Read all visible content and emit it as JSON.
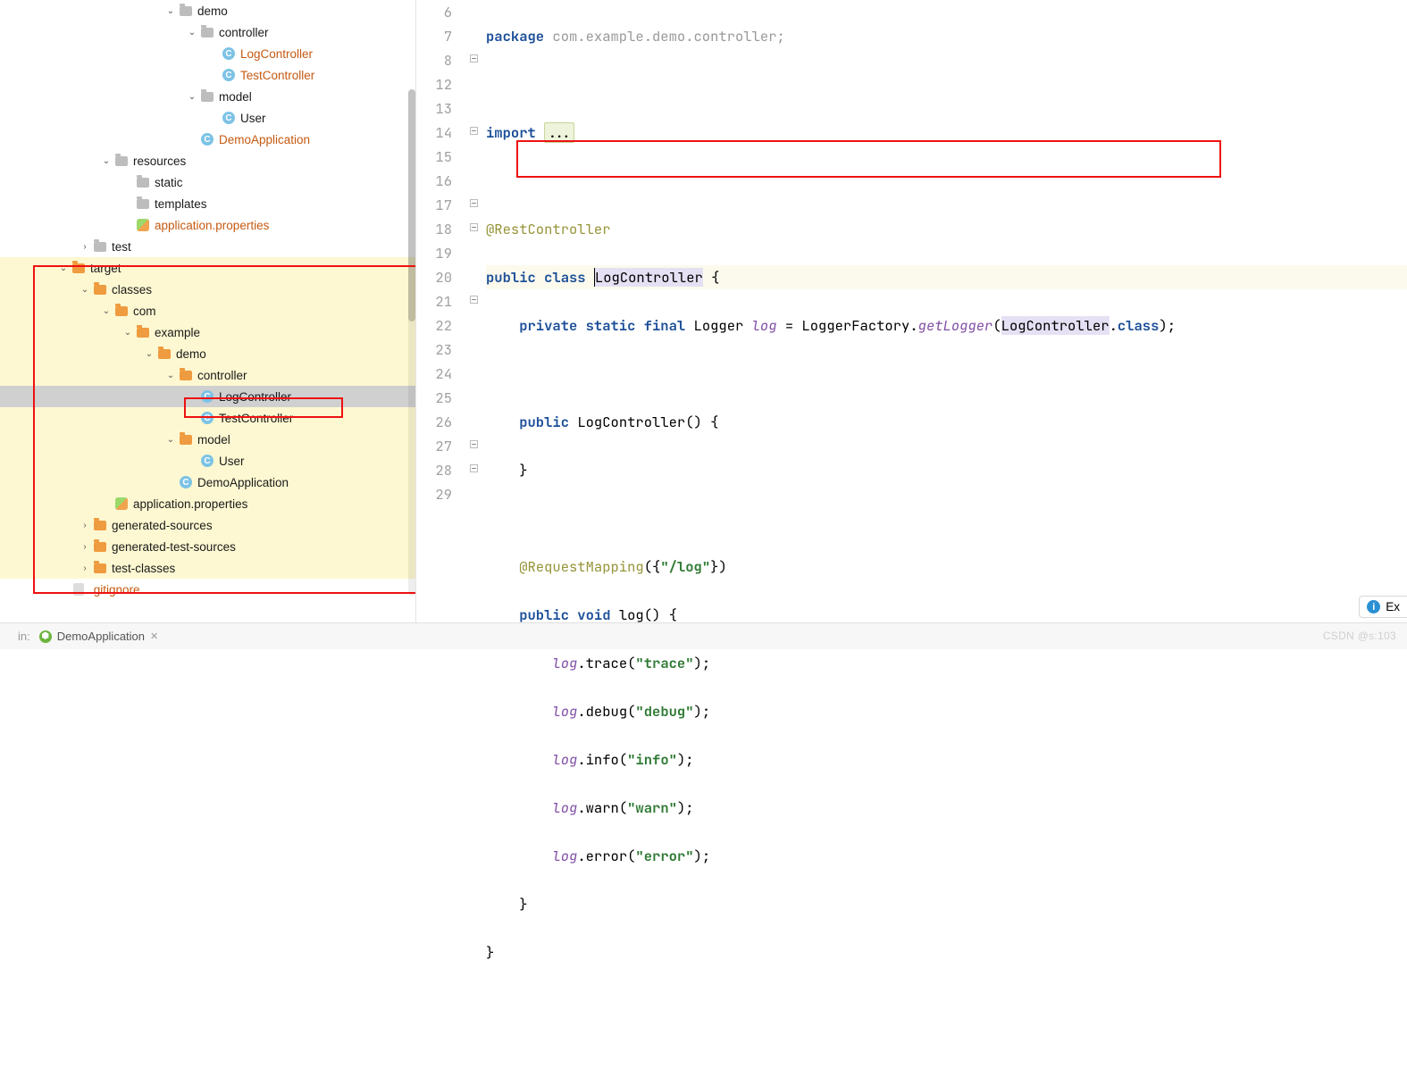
{
  "tree": [
    {
      "indent": 6,
      "arrow": "down",
      "icon": "folder-grey",
      "label": "demo"
    },
    {
      "indent": 7,
      "arrow": "down",
      "icon": "folder-grey",
      "label": "controller"
    },
    {
      "indent": 8,
      "arrow": "",
      "icon": "class",
      "label": "LogController",
      "orange": true
    },
    {
      "indent": 8,
      "arrow": "",
      "icon": "class",
      "label": "TestController",
      "orange": true
    },
    {
      "indent": 7,
      "arrow": "down",
      "icon": "folder-grey",
      "label": "model"
    },
    {
      "indent": 8,
      "arrow": "",
      "icon": "class",
      "label": "User"
    },
    {
      "indent": 7,
      "arrow": "",
      "icon": "class",
      "label": "DemoApplication",
      "orange": true
    },
    {
      "indent": 3,
      "arrow": "down",
      "icon": "folder-grey",
      "label": "resources"
    },
    {
      "indent": 4,
      "arrow": "",
      "icon": "folder-grey",
      "label": "static"
    },
    {
      "indent": 4,
      "arrow": "",
      "icon": "folder-grey",
      "label": "templates"
    },
    {
      "indent": 4,
      "arrow": "",
      "icon": "prop",
      "label": "application.properties",
      "orange": true
    },
    {
      "indent": 2,
      "arrow": "right",
      "icon": "folder-grey",
      "label": "test"
    },
    {
      "indent": 1,
      "arrow": "down",
      "icon": "folder-orange",
      "label": "target",
      "hl": true
    },
    {
      "indent": 2,
      "arrow": "down",
      "icon": "folder-orange",
      "label": "classes",
      "hl": true
    },
    {
      "indent": 3,
      "arrow": "down",
      "icon": "folder-orange",
      "label": "com",
      "hl": true
    },
    {
      "indent": 4,
      "arrow": "down",
      "icon": "folder-orange",
      "label": "example",
      "hl": true
    },
    {
      "indent": 5,
      "arrow": "down",
      "icon": "folder-orange",
      "label": "demo",
      "hl": true
    },
    {
      "indent": 6,
      "arrow": "down",
      "icon": "folder-orange",
      "label": "controller",
      "hl": true
    },
    {
      "indent": 7,
      "arrow": "",
      "icon": "class",
      "label": "LogController",
      "hl": true,
      "selected": true
    },
    {
      "indent": 7,
      "arrow": "",
      "icon": "class",
      "label": "TestController",
      "hl": true
    },
    {
      "indent": 6,
      "arrow": "down",
      "icon": "folder-orange",
      "label": "model",
      "hl": true
    },
    {
      "indent": 7,
      "arrow": "",
      "icon": "class",
      "label": "User",
      "hl": true
    },
    {
      "indent": 6,
      "arrow": "",
      "icon": "class",
      "label": "DemoApplication",
      "hl": true
    },
    {
      "indent": 3,
      "arrow": "",
      "icon": "prop",
      "label": "application.properties",
      "hl": true
    },
    {
      "indent": 2,
      "arrow": "right",
      "icon": "folder-orange",
      "label": "generated-sources",
      "hl": true
    },
    {
      "indent": 2,
      "arrow": "right",
      "icon": "folder-orange",
      "label": "generated-test-sources",
      "hl": true
    },
    {
      "indent": 2,
      "arrow": "right",
      "icon": "folder-orange",
      "label": "test-classes",
      "hl": true
    },
    {
      "indent": 1,
      "arrow": "",
      "icon": "file",
      "label": ".gitignore",
      "orange": true
    }
  ],
  "lineNumbers": [
    "6",
    "7",
    "8",
    "12",
    "13",
    "14",
    "15",
    "16",
    "17",
    "18",
    "19",
    "20",
    "21",
    "22",
    "23",
    "24",
    "25",
    "26",
    "27",
    "28",
    "29"
  ],
  "code": {
    "l0a": "package",
    "l0b": " com.example.demo.controller;",
    "l2a": "import ",
    "l2b": "...",
    "l4": "@RestController",
    "l5a": "public class ",
    "l5b": "LogController",
    "l5c": " {",
    "l6a": "private static final",
    "l6b": " Logger ",
    "l6c": "log",
    "l6d": " = LoggerFactory.",
    "l6e": "getLogger",
    "l6f": "(",
    "l6g": "LogController",
    "l6h": ".",
    "l6i": "class",
    "l6j": ");",
    "l8a": "public",
    "l8b": " LogController() {",
    "l9a": "}",
    "l11a": "@RequestMapping",
    "l11b": "({",
    "l11c": "\"/log\"",
    "l11d": "})",
    "l12a": "public void",
    "l12b": " log() {",
    "l13a": "log",
    "l13b": ".trace(",
    "l13c": "\"trace\"",
    "l13d": ");",
    "l14a": "log",
    "l14b": ".debug(",
    "l14c": "\"debug\"",
    "l14d": ");",
    "l15a": "log",
    "l15b": ".info(",
    "l15c": "\"info\"",
    "l15d": ");",
    "l16a": "log",
    "l16b": ".warn(",
    "l16c": "\"warn\"",
    "l16d": ");",
    "l17a": "log",
    "l17b": ".error(",
    "l17c": "\"error\"",
    "l17d": ");",
    "l18a": "}",
    "l19a": "}"
  },
  "runConfig": "DemoApplication",
  "rightPill": "Ex",
  "watermark": "CSDN @s:103"
}
